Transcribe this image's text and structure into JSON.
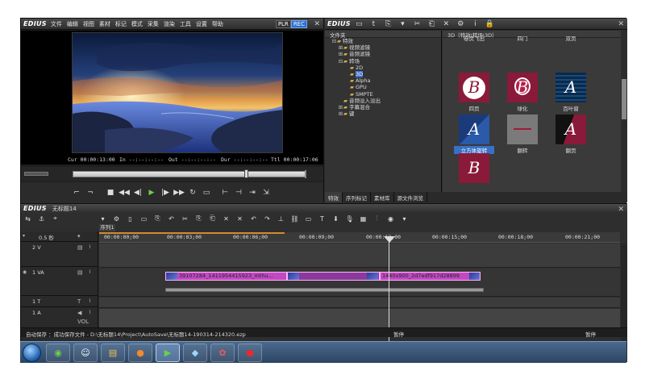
{
  "player": {
    "logo": "EDIUS",
    "menu": [
      "文件",
      "编辑",
      "视图",
      "素材",
      "标记",
      "模式",
      "采集",
      "渲染",
      "工具",
      "设置",
      "帮助"
    ],
    "plr": "PLR",
    "rec": "REC",
    "cur": "Cur 00:00:13:00",
    "in": "In --:--:--:--",
    "out": "Out --:--:--:--",
    "dur": "Dur --:--:--:--",
    "ttl": "Ttl 00:00:17:06"
  },
  "palette": {
    "tree_header": "文件夹",
    "tree": [
      {
        "toggle": "⊟",
        "label": "特效",
        "indent": 1,
        "selected": false
      },
      {
        "toggle": "⊞",
        "label": "视频滤镜",
        "indent": 2,
        "selected": false
      },
      {
        "toggle": "⊞",
        "label": "音频滤镜",
        "indent": 2,
        "selected": false
      },
      {
        "toggle": "⊟",
        "label": "转场",
        "indent": 2,
        "selected": false
      },
      {
        "toggle": "",
        "label": "2D",
        "indent": 3,
        "selected": false
      },
      {
        "toggle": "",
        "label": "3D",
        "indent": 3,
        "selected": true
      },
      {
        "toggle": "",
        "label": "Alpha",
        "indent": 3,
        "selected": false
      },
      {
        "toggle": "",
        "label": "GPU",
        "indent": 3,
        "selected": false
      },
      {
        "toggle": "",
        "label": "SMPTE",
        "indent": 3,
        "selected": false
      },
      {
        "toggle": "",
        "label": "音频淡入淡出",
        "indent": 2,
        "selected": false
      },
      {
        "toggle": "⊞",
        "label": "字幕混合",
        "indent": 2,
        "selected": false
      },
      {
        "toggle": "⊞",
        "label": "键",
        "indent": 2,
        "selected": false
      }
    ],
    "thumbs_header": "3D（特效\\转场\\3D）",
    "thumbs": [
      {
        "label": "卷页飞出",
        "letter": "",
        "style": "none",
        "selected": false
      },
      {
        "label": "四门",
        "letter": "",
        "style": "none",
        "selected": false
      },
      {
        "label": "双页",
        "letter": "",
        "style": "none",
        "selected": false
      },
      {
        "label": "四页",
        "letter": "B",
        "style": "circle",
        "selected": false
      },
      {
        "label": "球化",
        "letter": "B",
        "style": "ball",
        "selected": false
      },
      {
        "label": "百叶窗",
        "letter": "A",
        "style": "blind",
        "selected": false
      },
      {
        "label": "立方体旋转",
        "letter": "A",
        "style": "cube",
        "selected": true
      },
      {
        "label": "翻转",
        "letter": "",
        "style": "flip",
        "selected": false
      },
      {
        "label": "翻页",
        "letter": "A",
        "style": "page",
        "selected": false
      },
      {
        "label": "",
        "letter": "B",
        "style": "plain",
        "selected": false
      }
    ],
    "tabs": [
      "特效",
      "序列标记",
      "素材库",
      "源文件浏览"
    ]
  },
  "timeline": {
    "logo": "EDIUS",
    "project": "无标题14",
    "sequence_tab": "序列1",
    "zoom": "0.5 秒",
    "ticks": [
      "00:00:00;00",
      "00:00:03;00",
      "00:00:06;00",
      "00:00:09;00",
      "00:00:12;00",
      "00:00:15;00",
      "00:00:18;00",
      "00:00:21;00"
    ],
    "tracks": [
      {
        "label": "2 V",
        "icon": "▤"
      },
      {
        "label": "1 VA",
        "icon": "▤"
      },
      {
        "label": "1 T",
        "icon": "T"
      },
      {
        "label": "1 A",
        "icon": "◀"
      }
    ],
    "clip1": "39107284_1411954415923_mthu...",
    "clip2": "1440x900_2d7edf917d28899",
    "vol_label": "VOL",
    "status_autosave": "自动保存 ：成功保存文件 - D:\\无标题14\\Project\\AutoSave\\无标题14-190314-214320.ezp",
    "status_pause1": "暂停",
    "status_pause2": "暂停"
  },
  "colors": {
    "clip": "#c04ac0",
    "accent_blue": "#3a6fc8",
    "rec_blue": "#2a6fd0"
  }
}
